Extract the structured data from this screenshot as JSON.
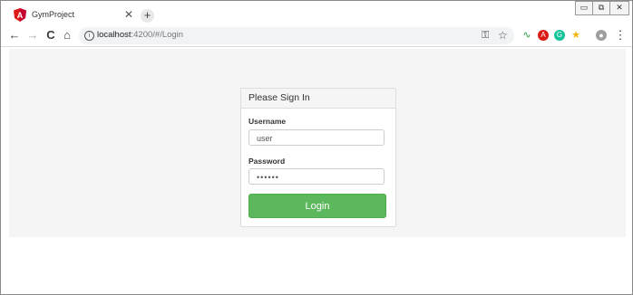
{
  "window": {
    "minimize_glyph": "▭",
    "restore_glyph": "⧉",
    "close_glyph": "✕"
  },
  "tab": {
    "title": "GymProject",
    "close_glyph": "✕",
    "favicon": "angular-icon",
    "new_tab_glyph": "+"
  },
  "toolbar": {
    "back_glyph": "←",
    "forward_glyph": "→",
    "reload_glyph": "C",
    "home_glyph": "⌂",
    "url_host": "localhost",
    "url_path": ":4200/#/Login",
    "info_glyph": "i",
    "key_glyph": "⚿",
    "star_glyph": "☆",
    "extensions": [
      {
        "name": "wave-extension-icon",
        "glyph": "∿",
        "color": "#2e9e44"
      },
      {
        "name": "angular-extension-icon",
        "glyph": "A",
        "color": "#dd1b16"
      },
      {
        "name": "grammarly-extension-icon",
        "glyph": "G",
        "color": "#15c39a"
      },
      {
        "name": "star-extension-icon",
        "glyph": "★",
        "color": "#f4b400"
      }
    ],
    "profile_glyph": "●",
    "menu_glyph": "⋮"
  },
  "login": {
    "heading": "Please Sign In",
    "username_label": "Username",
    "username_value": "user",
    "password_label": "Password",
    "password_value": "••••••",
    "submit_label": "Login"
  },
  "colors": {
    "login_button": "#5cb85c",
    "page_background": "#f5f5f5"
  }
}
